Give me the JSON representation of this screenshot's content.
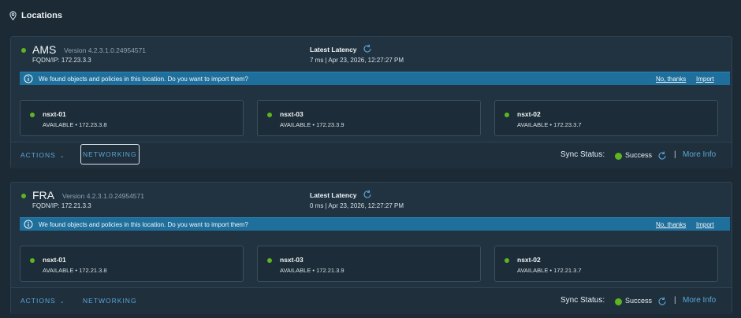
{
  "page": {
    "title": "Locations"
  },
  "locations": [
    {
      "name": "AMS",
      "version": "Version 4.2.3.1.0.24954571",
      "fqdn": "FQDN/IP: 172.23.3.3",
      "latency_title": "Latest Latency",
      "latency_value": "7 ms | Apr 23, 2026, 12:27:27 PM",
      "banner": {
        "message": "We found objects and policies in this location. Do you want to import them?",
        "no_thanks": "No, thanks",
        "import": "Import"
      },
      "tiles": [
        {
          "name": "nsxt-01",
          "status": "AVAILABLE • 172.23.3.8"
        },
        {
          "name": "nsxt-03",
          "status": "AVAILABLE • 172.23.3.9"
        },
        {
          "name": "nsxt-02",
          "status": "AVAILABLE • 172.23.3.7"
        }
      ],
      "footer": {
        "actions": "ACTIONS",
        "networking": "NETWORKING",
        "sync_label": "Sync Status:",
        "sync_value": "Success",
        "separator": "|",
        "more_info": "More Info"
      }
    },
    {
      "name": "FRA",
      "version": "Version 4.2.3.1.0.24954571",
      "fqdn": "FQDN/IP: 172.21.3.3",
      "latency_title": "Latest Latency",
      "latency_value": "0 ms | Apr 23, 2026, 12:27:27 PM",
      "banner": {
        "message": "We found objects and policies in this location. Do you want to import them?",
        "no_thanks": "No, thanks",
        "import": "Import"
      },
      "tiles": [
        {
          "name": "nsxt-01",
          "status": "AVAILABLE • 172.21.3.8"
        },
        {
          "name": "nsxt-03",
          "status": "AVAILABLE • 172.21.3.9"
        },
        {
          "name": "nsxt-02",
          "status": "AVAILABLE • 172.21.3.7"
        }
      ],
      "footer": {
        "actions": "ACTIONS",
        "networking": "NETWORKING",
        "sync_label": "Sync Status:",
        "sync_value": "Success",
        "separator": "|",
        "more_info": "More Info"
      }
    }
  ],
  "colors": {
    "status_green": "#5db51f",
    "banner_blue": "#1f6f9c",
    "link_blue": "#5aa7d8"
  },
  "icons": [
    "location-pin-icon",
    "refresh-icon",
    "info-icon",
    "caret-down-icon",
    "status-dot-icon"
  ]
}
